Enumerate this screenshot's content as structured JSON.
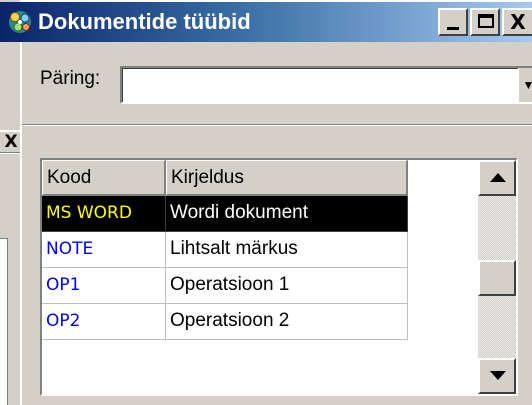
{
  "window": {
    "title": "Dokumentide tüübid",
    "close_glyph": "X"
  },
  "background_window": {
    "close_glyph": "X"
  },
  "query": {
    "label": "Päring:",
    "value": ""
  },
  "grid": {
    "columns": [
      "Kood",
      "Kirjeldus"
    ],
    "rows": [
      {
        "code": "MS WORD",
        "description": "Wordi dokument",
        "selected": true
      },
      {
        "code": "NOTE",
        "description": "Lihtsalt märkus",
        "selected": false
      },
      {
        "code": "OP1",
        "description": "Operatsioon 1",
        "selected": false
      },
      {
        "code": "OP2",
        "description": "Operatsioon 2",
        "selected": false
      }
    ]
  },
  "icons": {
    "app": "gear-cluster-icon",
    "minimize": "minimize-icon",
    "maximize": "maximize-icon",
    "close": "close-icon",
    "dropdown": "chevron-down-icon",
    "scroll_up": "arrow-up-icon",
    "scroll_down": "arrow-down-icon"
  },
  "colors": {
    "titlebar_start": "#0a246a",
    "titlebar_end": "#a6caf0",
    "code_text": "#0000ff",
    "selected_bg": "#000000",
    "selected_code": "#ffff00",
    "selected_desc": "#ffffff",
    "face": "#d4d0c8"
  }
}
